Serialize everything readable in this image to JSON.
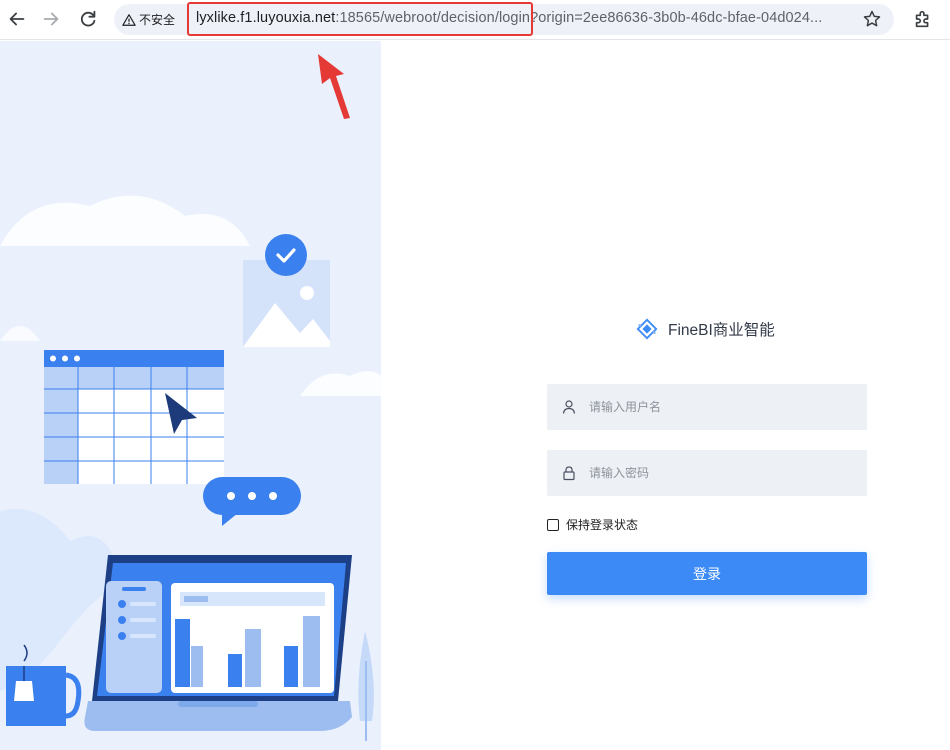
{
  "browser": {
    "security_label": "不安全",
    "url_host": "lyxlike.f1.luyouxia.net",
    "url_rest": ":18565/webroot/decision/login?origin=2ee86636-3b0b-46dc-bfae-04d024..."
  },
  "login": {
    "brand_title": "FineBI商业智能",
    "username_placeholder": "请输入用户名",
    "password_placeholder": "请输入密码",
    "remember_label": "保持登录状态",
    "submit_label": "登录"
  },
  "colors": {
    "primary": "#3b8af6",
    "illustration_bg": "#eaf1fd",
    "annotation_red": "#e53935",
    "field_bg": "#edf0f4"
  },
  "icons": [
    "back-arrow-icon",
    "forward-arrow-icon",
    "reload-icon",
    "warning-icon",
    "star-icon",
    "extensions-icon",
    "finebi-logo-icon",
    "user-icon",
    "lock-icon"
  ]
}
